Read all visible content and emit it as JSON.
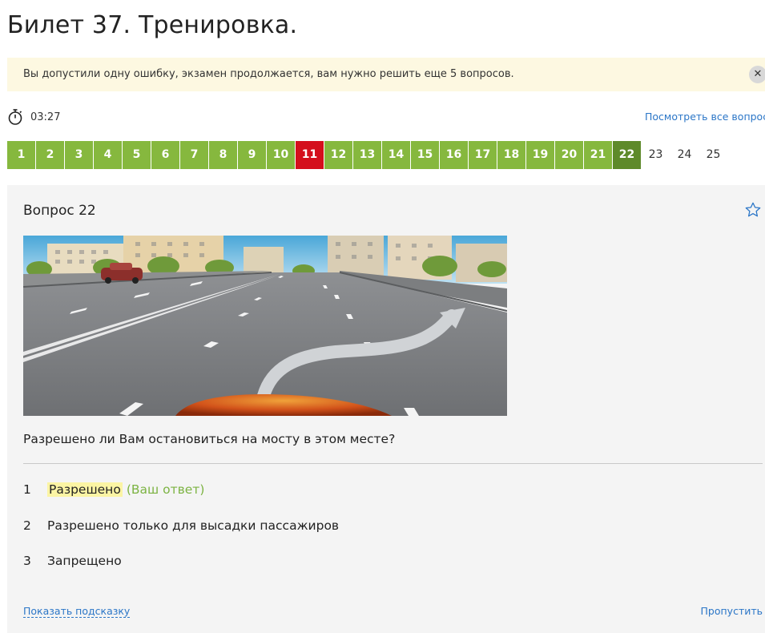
{
  "page": {
    "title": "Билет 37. Тренировка."
  },
  "alert": {
    "text": "Вы допустили одну ошибку, экзамен продолжается, вам нужно решить еще 5 вопросов.",
    "close_glyph": "✕"
  },
  "timer": {
    "time": "03:27"
  },
  "view_all": {
    "label": "Посмотреть все вопросы"
  },
  "questions_nav": [
    {
      "label": "1",
      "state": "answered"
    },
    {
      "label": "2",
      "state": "answered"
    },
    {
      "label": "3",
      "state": "answered"
    },
    {
      "label": "4",
      "state": "answered"
    },
    {
      "label": "5",
      "state": "answered"
    },
    {
      "label": "6",
      "state": "answered"
    },
    {
      "label": "7",
      "state": "answered"
    },
    {
      "label": "8",
      "state": "answered"
    },
    {
      "label": "9",
      "state": "answered"
    },
    {
      "label": "10",
      "state": "answered"
    },
    {
      "label": "11",
      "state": "wrong"
    },
    {
      "label": "12",
      "state": "answered"
    },
    {
      "label": "13",
      "state": "answered"
    },
    {
      "label": "14",
      "state": "answered"
    },
    {
      "label": "15",
      "state": "answered"
    },
    {
      "label": "16",
      "state": "answered"
    },
    {
      "label": "17",
      "state": "answered"
    },
    {
      "label": "18",
      "state": "answered"
    },
    {
      "label": "19",
      "state": "answered"
    },
    {
      "label": "20",
      "state": "answered"
    },
    {
      "label": "21",
      "state": "answered"
    },
    {
      "label": "22",
      "state": "current"
    },
    {
      "label": "23",
      "state": "pending"
    },
    {
      "label": "24",
      "state": "pending"
    },
    {
      "label": "25",
      "state": "pending"
    }
  ],
  "question": {
    "title": "Вопрос 22",
    "text": "Разрешено ли Вам остановиться на мосту в этом месте?",
    "answers": [
      {
        "num": "1",
        "text": "Разрешено",
        "note": "(Ваш ответ)"
      },
      {
        "num": "2",
        "text": "Разрешено только для высадки пассажиров"
      },
      {
        "num": "3",
        "text": "Запрещено"
      }
    ]
  },
  "footer": {
    "hint_label": "Показать подсказку",
    "skip_label": "Пропустить"
  },
  "colors": {
    "answered": "#86b83e",
    "wrong": "#d40f1c",
    "current": "#5e8a2a",
    "link": "#2b76c7",
    "alert_bg": "#fdf8e1",
    "your_answer": "#7cb342",
    "highlight": "#fbf4a4"
  },
  "icons": {
    "timer": "stopwatch-icon",
    "star": "star-outline-icon",
    "close": "close-icon"
  }
}
